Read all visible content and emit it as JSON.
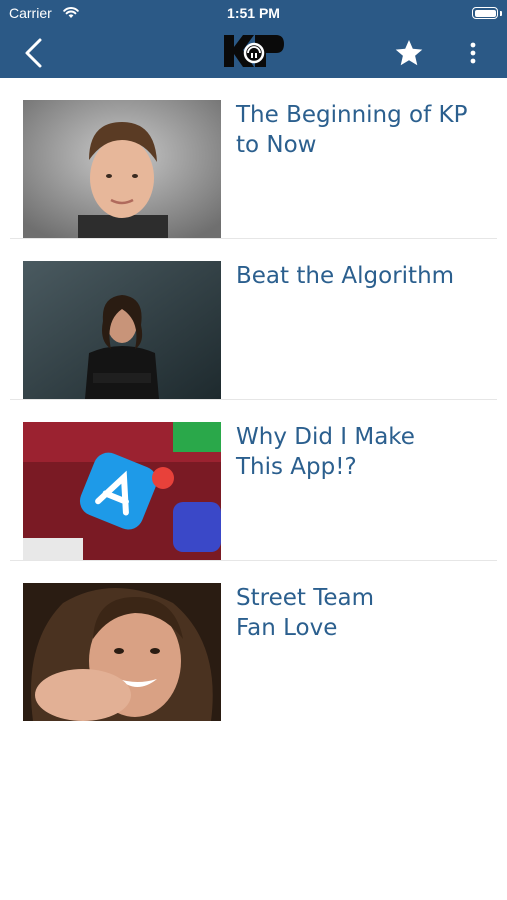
{
  "status_bar": {
    "carrier": "Carrier",
    "time": "1:51 PM"
  },
  "nav": {
    "back_icon": "chevron-left-icon",
    "logo": "KP",
    "favorite_icon": "star-icon",
    "more_icon": "more-vertical-icon",
    "bar_color": "#2b5986"
  },
  "articles": [
    {
      "title": "The Beginning of KP\nto Now",
      "image": "child-portrait"
    },
    {
      "title": "Beat the Algorithm",
      "image": "man-arms-crossed"
    },
    {
      "title": "Why Did I Make\nThis App!?",
      "image": "app-store-icon-phone"
    },
    {
      "title": "Street Team\nFan Love",
      "image": "man-pointing"
    }
  ],
  "colors": {
    "title": "#2b5f8e",
    "separator": "#e6e6e6"
  }
}
